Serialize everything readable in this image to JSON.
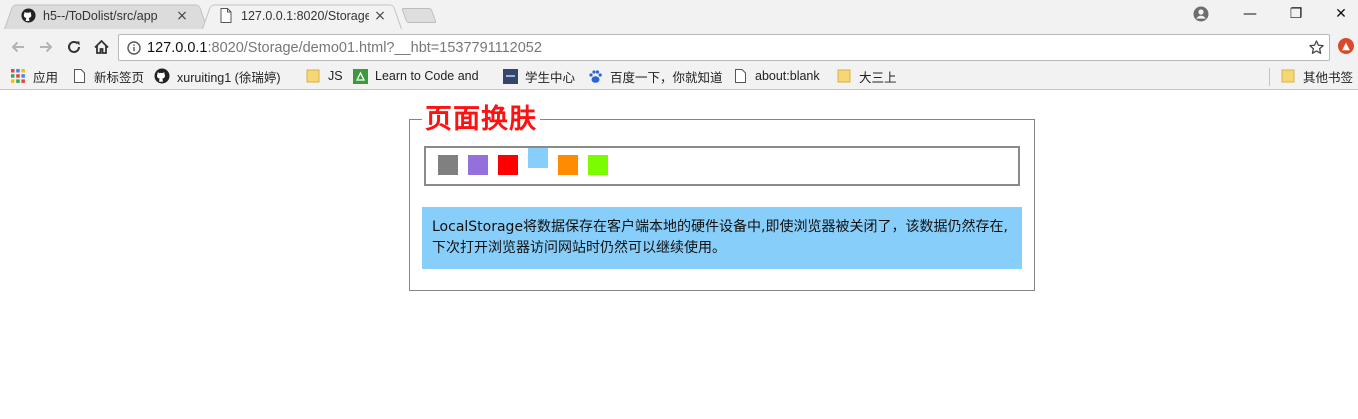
{
  "tabs": [
    {
      "title": "h5--/ToDolist/src/app",
      "icon": "github-icon",
      "state": "inactive"
    },
    {
      "title": "127.0.0.1:8020/Storage",
      "icon": "page-icon",
      "state": "active"
    }
  ],
  "tab_close": "×",
  "window_controls": {
    "minimize": "—",
    "restore": "❐",
    "close": "✕"
  },
  "address_bar": {
    "host": "127.0.0.1",
    "rest": ":8020/Storage/demo01.html?__hbt=1537791112052"
  },
  "bookmarks": [
    {
      "label": "应用",
      "icon": "apps-grid-icon"
    },
    {
      "label": "新标签页",
      "icon": "page-icon"
    },
    {
      "label": "xuruiting1 (徐瑞婷)",
      "icon": "github-icon"
    },
    {
      "label": "JS",
      "icon": "folder-icon"
    },
    {
      "label": "Learn to Code and",
      "icon": "code-camp-icon"
    },
    {
      "label": "学生中心",
      "icon": "student-center-icon"
    },
    {
      "label": "百度一下，你就知道",
      "icon": "baidu-paw-icon"
    },
    {
      "label": "about:blank",
      "icon": "page-icon"
    },
    {
      "label": "大三上",
      "icon": "folder-icon"
    }
  ],
  "other_bookmarks": {
    "label": "其他书签",
    "icon": "folder-icon"
  },
  "page": {
    "title": "页面换肤",
    "swatches": [
      {
        "color": "#808080",
        "name": "gray"
      },
      {
        "color": "#9370db",
        "name": "purple"
      },
      {
        "color": "#ff0000",
        "name": "red"
      },
      {
        "color": "#87cefa",
        "name": "lightskyblue",
        "selected": true
      },
      {
        "color": "#ff8c00",
        "name": "orange"
      },
      {
        "color": "#7cfc00",
        "name": "lawngreen"
      }
    ],
    "info_text": "LocalStorage将数据保存在客户端本地的硬件设备中,即使浏览器被关闭了，该数据仍然存在,下次打开浏览器访问网站时仍然可以继续使用。",
    "info_bg": "#87cefa",
    "title_color": "#ff1111"
  }
}
